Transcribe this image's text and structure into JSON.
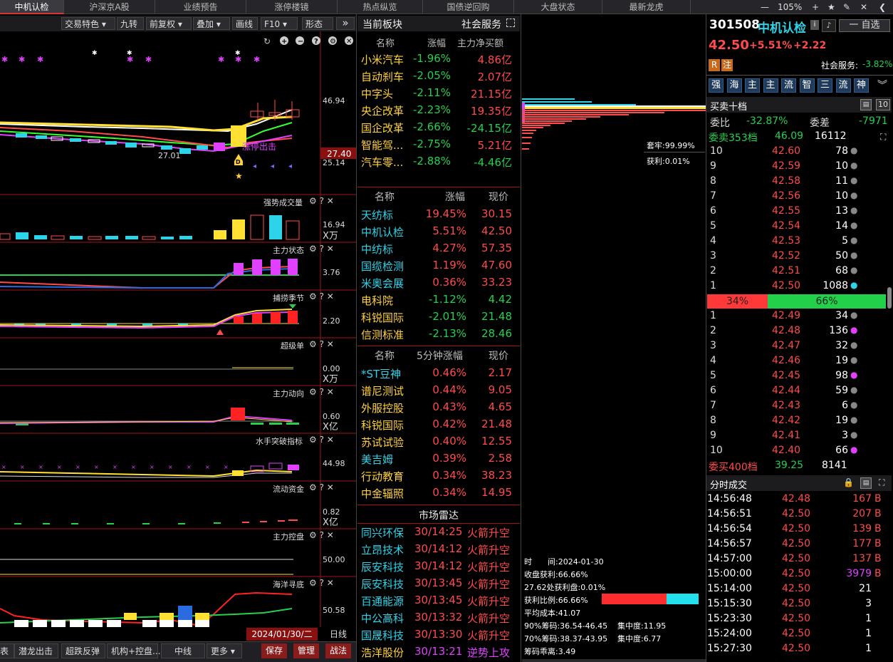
{
  "topnav": {
    "tabs": [
      "中机认检",
      "沪深京A股",
      "业绩预告",
      "涨停楼镜",
      "热点纵览",
      "国债逆回购",
      "大盘状态",
      "最新龙虎"
    ],
    "zoom": "105%",
    "minus": "—",
    "plus": "+",
    "star": "★",
    "pen": "✎",
    "close": "✕",
    "left": "❮"
  },
  "toolbar": {
    "items": [
      "交易特色",
      "九转",
      "前复权",
      "叠加",
      "画线",
      "F10",
      "形态"
    ],
    "more": "»"
  },
  "kline": {
    "price_high": "46.94",
    "price_low": "25.14",
    "cur_price": "27.40",
    "min_label": "27.01",
    "limit_label": "涨停出击",
    "d_label": "D"
  },
  "panels": [
    {
      "title": "强势成交量",
      "val": "16.94",
      "unit": "X万"
    },
    {
      "title": "主力状态",
      "val": "3.76",
      "unit": ""
    },
    {
      "title": "捕捞季节",
      "val": "2.20",
      "unit": ""
    },
    {
      "title": "超级单",
      "val": "0.00",
      "unit": "X万"
    },
    {
      "title": "主力动向",
      "val": "0.60",
      "unit": "X亿"
    },
    {
      "title": "水手突破指标",
      "val": "44.98",
      "unit": ""
    },
    {
      "title": "流动资金",
      "val": "0.82",
      "unit": "X亿"
    },
    {
      "title": "主力控盘",
      "val": "50.00",
      "unit": ""
    },
    {
      "title": "海洋寻底",
      "val": "50.58",
      "unit": ""
    }
  ],
  "chart_bottom": {
    "date": "2024/01/30/二",
    "period": "日线"
  },
  "bottom_tabs": [
    "表",
    "潜龙出击",
    "超跌反弹",
    "机构+控盘...",
    "中线",
    "更多"
  ],
  "bottom_right": [
    "保存",
    "管理",
    "战法"
  ],
  "sector": {
    "title": "当前板块",
    "sub": "社会服务",
    "cols": [
      "名称",
      "涨幅",
      "主力净买额"
    ],
    "rows": [
      [
        "小米汽车",
        "-1.96%",
        "4.86亿"
      ],
      [
        "自动刹车",
        "-2.05%",
        "2.07亿"
      ],
      [
        "中字头",
        "-2.11%",
        "21.15亿"
      ],
      [
        "央企改革",
        "-2.23%",
        "19.35亿"
      ],
      [
        "国企改革",
        "-2.66%",
        "-24.15亿"
      ],
      [
        "智能驾...",
        "-2.75%",
        "5.21亿"
      ],
      [
        "汽车零...",
        "-2.88%",
        "-4.46亿"
      ]
    ]
  },
  "stocks": {
    "cols": [
      "名称",
      "涨幅",
      "现价"
    ],
    "rows": [
      [
        "天纺标",
        "19.45%",
        "30.15"
      ],
      [
        "中机认检",
        "5.51%",
        "42.50"
      ],
      [
        "中纺标",
        "4.27%",
        "57.35"
      ],
      [
        "国缆检测",
        "1.19%",
        "47.60"
      ],
      [
        "米奥会展",
        "0.36%",
        "33.23"
      ],
      [
        "电科院",
        "-1.12%",
        "4.42"
      ],
      [
        "科锐国际",
        "-2.01%",
        "21.48"
      ],
      [
        "信测标准",
        "-2.13%",
        "28.46"
      ]
    ]
  },
  "fivemin": {
    "cols": [
      "名称",
      "5分钟涨幅",
      "现价"
    ],
    "rows": [
      [
        "*ST豆神",
        "0.46%",
        "2.17"
      ],
      [
        "谱尼测试",
        "0.44%",
        "9.05"
      ],
      [
        "外服控股",
        "0.43%",
        "4.65"
      ],
      [
        "科锐国际",
        "0.42%",
        "21.48"
      ],
      [
        "苏试试验",
        "0.40%",
        "12.55"
      ],
      [
        "美吉姆",
        "0.39%",
        "2.58"
      ],
      [
        "行动教育",
        "0.34%",
        "38.23"
      ],
      [
        "中金辐照",
        "0.34%",
        "14.95"
      ]
    ]
  },
  "radar": {
    "title": "市场雷达",
    "rows": [
      [
        "同兴环保",
        "30/14:25",
        "火箭升空"
      ],
      [
        "立昂技术",
        "30/14:12",
        "火箭升空"
      ],
      [
        "辰安科技",
        "30/14:12",
        "火箭升空"
      ],
      [
        "辰安科技",
        "30/13:45",
        "火箭升空"
      ],
      [
        "百通能源",
        "30/13:45",
        "火箭升空"
      ],
      [
        "中公高科",
        "30/13:32",
        "火箭升空"
      ],
      [
        "国晟科技",
        "30/13:30",
        "火箭升空"
      ],
      [
        "浩洋股份",
        "30/13:21",
        "逆势上攻"
      ]
    ]
  },
  "chip": {
    "trap": "套牢:99.99%",
    "profit": "获利:0.01%",
    "time": "时　　间:2024-01-30",
    "close_profit": "收盘获利:66.66%",
    "at_price": "27.62处获利盘:0.01%",
    "profit_ratio": "获利比例:66.66%",
    "avg_cost": "平均成本:41.07",
    "c90": "90%筹码:36.54-46.45",
    "conc90": "集中度:11.95",
    "c70": "70%筹码:38.37-43.95",
    "conc70": "集中度:6.77",
    "spread": "筹码乖离:3.49",
    "ratio_value": 0.6666
  },
  "quote": {
    "code": "301508",
    "name": "中机认检",
    "price": "42.50",
    "pct": "+5.51%",
    "chg": "+2.22",
    "tag_r": "R",
    "tag_z": "注",
    "sector": "社会服务:",
    "sector_pct": "-3.82%",
    "watch": "一 自选",
    "flags": [
      "强",
      "海",
      "主",
      "主",
      "流",
      "智",
      "三",
      "流",
      "神"
    ],
    "book_title": "买卖十档",
    "book_num": "10",
    "weibi_label": "委比",
    "weibi": "-32.87%",
    "weicha_label": "委差",
    "weicha": "-7971",
    "sell_total_label": "委卖353档",
    "sell_total_price": "46.09",
    "sell_total_vol": "16112",
    "asks": [
      [
        "10",
        "42.60",
        "78"
      ],
      [
        "9",
        "42.59",
        "10"
      ],
      [
        "8",
        "42.58",
        "11"
      ],
      [
        "7",
        "42.56",
        "10"
      ],
      [
        "6",
        "42.55",
        "13"
      ],
      [
        "5",
        "42.54",
        "14"
      ],
      [
        "4",
        "42.53",
        "5"
      ],
      [
        "3",
        "42.52",
        "50"
      ],
      [
        "2",
        "42.51",
        "68"
      ],
      [
        "1",
        "42.50",
        "1088"
      ]
    ],
    "ratio_sell": "34%",
    "ratio_buy": "66%",
    "ratio_sell_value": 0.34,
    "bids": [
      [
        "1",
        "42.49",
        "34"
      ],
      [
        "2",
        "42.48",
        "136"
      ],
      [
        "3",
        "42.47",
        "32"
      ],
      [
        "4",
        "42.46",
        "19"
      ],
      [
        "5",
        "42.45",
        "98"
      ],
      [
        "6",
        "42.44",
        "59"
      ],
      [
        "7",
        "42.43",
        "6"
      ],
      [
        "8",
        "42.42",
        "19"
      ],
      [
        "9",
        "42.41",
        "3"
      ],
      [
        "10",
        "42.40",
        "66"
      ]
    ],
    "buy_total_label": "委买400档",
    "buy_total_price": "39.25",
    "buy_total_vol": "8141",
    "ticks_title": "分时成交",
    "ticks": [
      [
        "14:56:48",
        "42.48",
        "167",
        "B"
      ],
      [
        "14:56:51",
        "42.50",
        "207",
        "B"
      ],
      [
        "14:56:54",
        "42.50",
        "139",
        "B"
      ],
      [
        "14:56:57",
        "42.50",
        "177",
        "B"
      ],
      [
        "14:57:00",
        "42.50",
        "137",
        "B"
      ],
      [
        "15:00:00",
        "42.50",
        "3979",
        "B"
      ],
      [
        "15:14:00",
        "42.50",
        "21",
        ""
      ],
      [
        "15:15:30",
        "42.50",
        "3",
        ""
      ],
      [
        "15:23:30",
        "42.50",
        "1",
        ""
      ],
      [
        "15:24:00",
        "42.50",
        "1",
        ""
      ],
      [
        "15:27:30",
        "42.50",
        "1",
        ""
      ]
    ]
  },
  "colors": {
    "up": "#ff4b4b",
    "down": "#26d04d",
    "bg": "#000000",
    "accent": "#a0161b",
    "cyan": "#2dd3e8",
    "yellow": "#ffd23a"
  }
}
